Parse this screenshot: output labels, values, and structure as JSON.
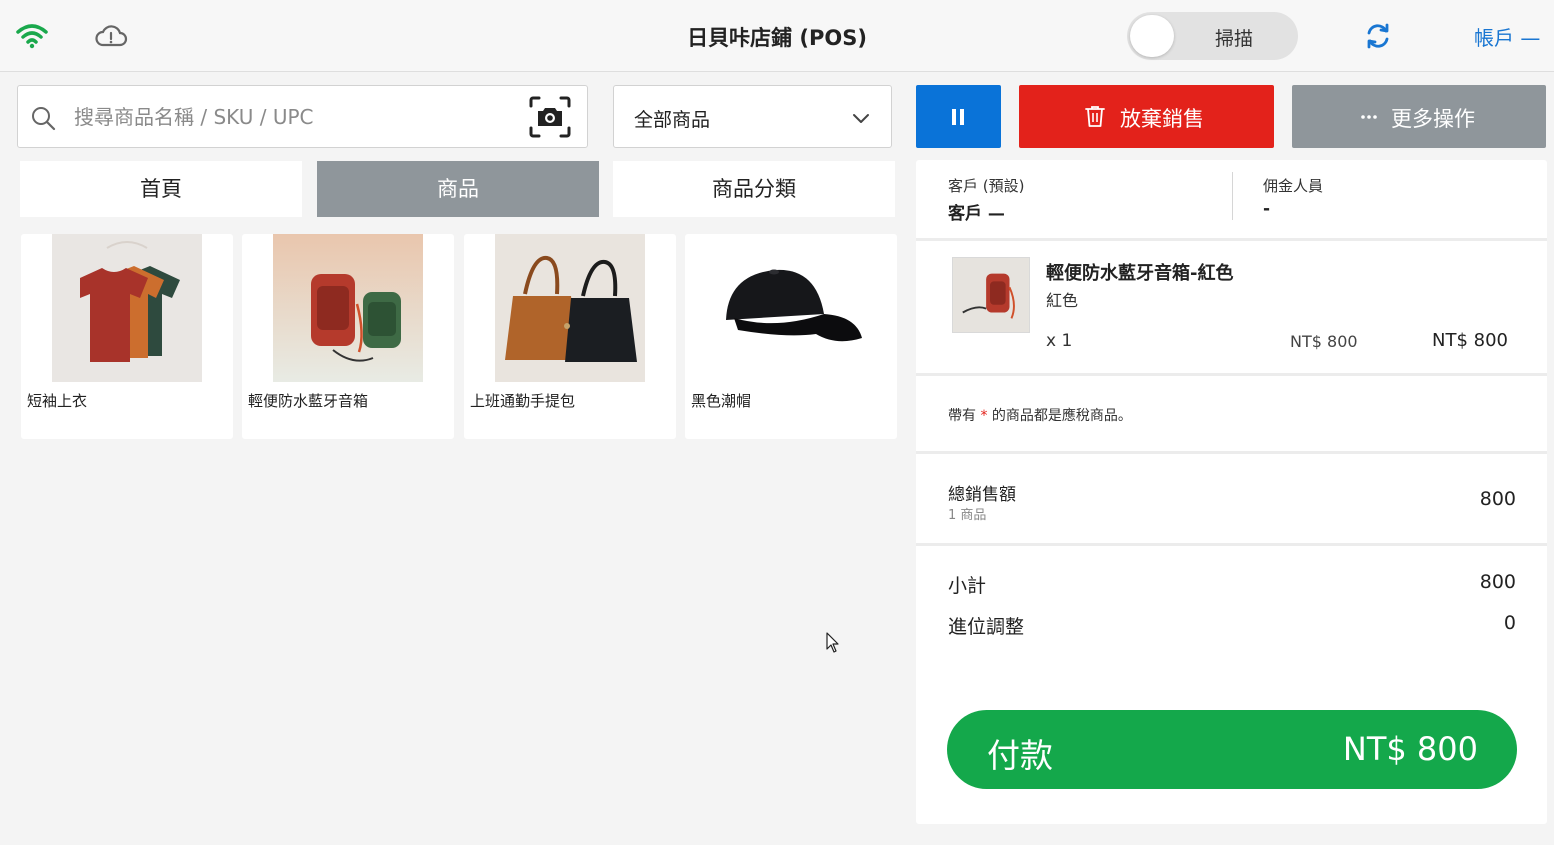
{
  "header": {
    "title": "日貝咔店鋪 (POS)",
    "scan_label": "掃描",
    "account_label": "帳戶 —",
    "wifi_color": "#1aa84c"
  },
  "search": {
    "placeholder": "搜尋商品名稱 / SKU / UPC"
  },
  "category_filter": {
    "selected": "全部商品"
  },
  "tabs": [
    {
      "label": "首頁",
      "active": false
    },
    {
      "label": "商品",
      "active": true
    },
    {
      "label": "商品分類",
      "active": false
    }
  ],
  "products": [
    {
      "name": "短袖上衣",
      "image": "tshirt"
    },
    {
      "name": "輕便防水藍牙音箱",
      "image": "speaker"
    },
    {
      "name": "上班通勤手提包",
      "image": "handbag"
    },
    {
      "name": "黑色潮帽",
      "image": "cap"
    }
  ],
  "actions": {
    "abandon_label": "放棄銷售",
    "more_label": "更多操作"
  },
  "cart": {
    "customer_label": "客戶 (預設)",
    "customer_value": "客戶 —",
    "commission_label": "佣金人員",
    "commission_value": "-",
    "items": [
      {
        "name": "輕便防水藍牙音箱-紅色",
        "variant": "紅色",
        "qty": "x 1",
        "unit_price": "NT$ 800",
        "line_total": "NT$ 800"
      }
    ],
    "tax_note_prefix": "帶有",
    "tax_note_asterisk": "*",
    "tax_note_suffix": "的商品都是應稅商品。",
    "total_label": "總銷售額",
    "total_count": "1 商品",
    "total_value": "800",
    "subtotal_label": "小計",
    "subtotal_value": "800",
    "rounding_label": "進位調整",
    "rounding_value": "0",
    "pay_label": "付款",
    "pay_amount": "NT$ 800"
  },
  "colors": {
    "primary_blue": "#0a73d8",
    "danger_red": "#e3221b",
    "neutral_gray": "#8f969b",
    "pay_green": "#14a84b"
  }
}
